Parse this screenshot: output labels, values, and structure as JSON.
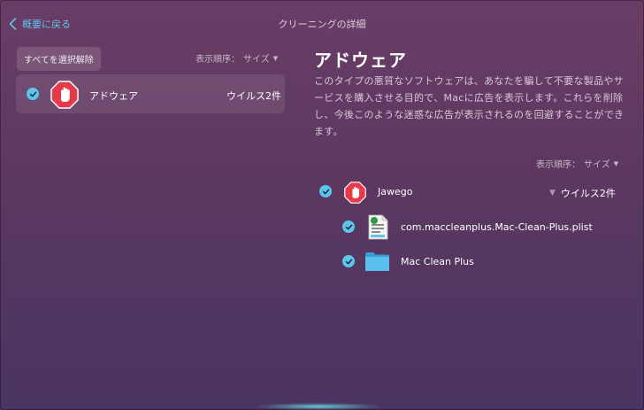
{
  "header": {
    "back_label": "概要に戻る",
    "title": "クリーニングの詳細"
  },
  "left_panel": {
    "deselect_all_label": "すべてを選択解除",
    "sort_label": "表示順序：",
    "sort_value": "サイズ",
    "category": {
      "name": "アドウェア",
      "count": "ウイルス2件",
      "checked": true,
      "icon": "stop-hand-icon"
    }
  },
  "detail": {
    "heading": "アドウェア",
    "description": "このタイプの悪質なソフトウェアは、あなたを騙して不要な製品やサービスを購入させる目的で、Macに広告を表示します。これらを削除し、今後このような迷惑な広告が表示されるのを回避することができます。",
    "sort_label": "表示順序：",
    "sort_value": "サイズ",
    "threat": {
      "name": "Jawego",
      "count": "ウイルス2件",
      "checked": true,
      "icon": "stop-hand-icon"
    },
    "files": [
      {
        "name": "com.maccleanplus.Mac-Clean-Plus.plist",
        "icon": "plist-file-icon",
        "checked": true
      },
      {
        "name": "Mac Clean Plus",
        "icon": "folder-icon",
        "checked": true
      }
    ]
  },
  "colors": {
    "accent": "#5cc6ea",
    "stop_red": "#e53a4a",
    "folder_blue": "#4ab4e8"
  }
}
